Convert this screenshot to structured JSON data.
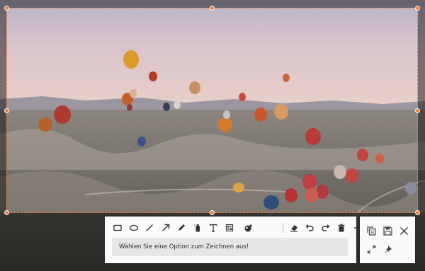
{
  "capture": {
    "accent_color": "#f07a3a"
  },
  "toolbar": {
    "tools": [
      {
        "name": "rectangle-icon"
      },
      {
        "name": "ellipse-icon"
      },
      {
        "name": "line-icon"
      },
      {
        "name": "arrow-icon"
      },
      {
        "name": "pen-icon"
      },
      {
        "name": "highlighter-icon"
      },
      {
        "name": "text-icon"
      },
      {
        "name": "mosaic-icon"
      },
      {
        "name": "blur-icon"
      },
      {
        "name": "eraser-icon"
      },
      {
        "name": "undo-icon"
      },
      {
        "name": "redo-icon"
      },
      {
        "name": "delete-icon"
      },
      {
        "name": "exit-icon"
      }
    ],
    "status_text": "Wählen Sie eine Option zum Zeichnen aus!"
  },
  "side_panel": {
    "buttons": [
      {
        "name": "copy-icon"
      },
      {
        "name": "save-icon"
      },
      {
        "name": "close-icon"
      },
      {
        "name": "fullscreen-icon"
      },
      {
        "name": "pin-icon"
      }
    ]
  }
}
